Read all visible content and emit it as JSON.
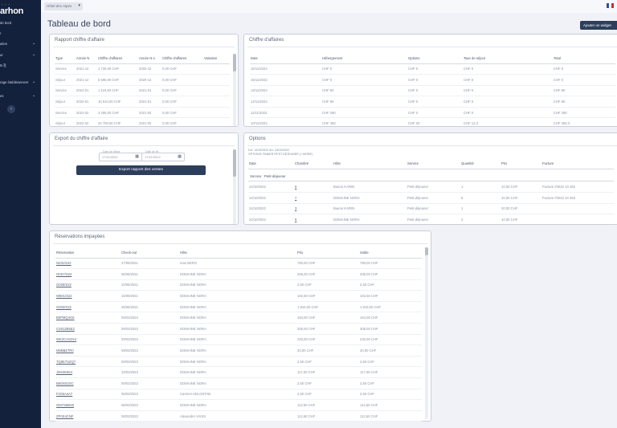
{
  "sidebar": {
    "logo_small": "/ / /",
    "logo": "arhon",
    "items": [
      {
        "label": "de bord",
        "chevron": ""
      },
      {
        "label": "r",
        "chevron": ""
      },
      {
        "label": "ation",
        "chevron": "⌄"
      },
      {
        "label": "ur",
        "chevron": "⌄"
      },
      {
        "label": "ts ⎘",
        "chevron": ""
      },
      {
        "label": "rage établissement",
        "chevron": "⌄"
      },
      {
        "label": "es",
        "chevron": "⌄"
      }
    ],
    "collapse_icon": "‹"
  },
  "topbar": {
    "env_select": "Hôtel des Alpes",
    "env_chevron": "▾",
    "flag_colors": [
      "#2b4fa8",
      "#ffffff",
      "#d2283a"
    ]
  },
  "page": {
    "title": "Tableau de bord",
    "add_widget": "Ajouter un widget"
  },
  "rapport": {
    "title": "Rapport chiffre d'affaire",
    "columns": [
      "Type",
      "Année N",
      "Chiffre d'affaires",
      "Année N-1",
      "Chiffre d'affaires",
      "Variation"
    ],
    "rows": [
      [
        "Service",
        "2021-12",
        "1 726,00 CHF",
        "2020-12",
        "0,00 CHF",
        ""
      ],
      [
        "Séjour",
        "2021-12",
        "8 595,00 CHF",
        "2020-12",
        "0,00 CHF",
        ""
      ],
      [
        "Service",
        "2022-01",
        "1 119,60 CHF",
        "2021-01",
        "0,00 CHF",
        ""
      ],
      [
        "Séjour",
        "2022-01",
        "10 510,00 CHF",
        "2021-01",
        "0,00 CHF",
        ""
      ],
      [
        "Service",
        "2022-02",
        "3 295,00 CHF",
        "2021-02",
        "0,00 CHF",
        ""
      ],
      [
        "Séjour",
        "2022-02",
        "24 700,00 CHF",
        "2021-02",
        "0,00 CHF",
        ""
      ]
    ]
  },
  "chiffre": {
    "title": "Chiffre d'affaires",
    "columns": [
      "Date",
      "Hébergement",
      "Options",
      "Taxe de séjour",
      "Total"
    ],
    "rows": [
      [
        "15/11/2022",
        "CHF 0",
        "CHF 0",
        "CHF 0",
        "CHF 0"
      ],
      [
        "15/11/2022",
        "CHF 0",
        "CHF 0",
        "CHF 0",
        "CHF 0"
      ],
      [
        "13/11/2022",
        "CHF 80",
        "CHF 0",
        "CHF 0",
        "CHF 80"
      ],
      [
        "12/11/2022",
        "CHF 80",
        "CHF 0",
        "CHF 0",
        "CHF 80"
      ],
      [
        "11/11/2022",
        "CHF 280",
        "CHF 0",
        "CHF 0",
        "CHF 280"
      ],
      [
        "10/11/2022",
        "CHF 460",
        "CHF 20",
        "CHF 12,3",
        "CHF 492,3"
      ]
    ]
  },
  "export": {
    "title": "Export du chiffre d'affaire",
    "from_label": "Date de début",
    "from_value": "17/11/2022",
    "to_label": "Date de fin",
    "to_value": "17/11/2022",
    "button": "Export rapport des ventes"
  },
  "options": {
    "title": "Options",
    "meta_line1": "DU: 14/10/2022 AU: 24/10/2022",
    "meta_line2": "OPTIONS: PANIER PETIT DÉJEUNER (+ MORE)",
    "columns": [
      "Date",
      "Chambre",
      "Hôte",
      "Service",
      "Quantité",
      "Prix",
      "Facture"
    ],
    "group_label": "Service : Petit-déjeuner",
    "rows": [
      [
        "24/10/2022",
        "0",
        "Bueno KARIN",
        "Petit-déjeuner",
        "1",
        "10,00 CHF",
        "Facture #2022 10 452"
      ],
      [
        "24/10/2022",
        "7",
        "DOMAINE NORA",
        "Petit-déjeuner",
        "6",
        "10,00 CHF",
        "Facture #2022 10 453"
      ],
      [
        "24/10/2022",
        "3",
        "Bueno KARIN",
        "Petit-déjeuner",
        "1",
        "20,00 CHF",
        ""
      ],
      [
        "24/10/2022",
        "6",
        "DOMAINE NORA",
        "Petit-déjeuner",
        "2",
        "10,00 CHF",
        ""
      ]
    ]
  },
  "reservations": {
    "title": "Réservations impayées",
    "columns": [
      "Réservation",
      "Check-out",
      "Hôte",
      "Prix",
      "Solde"
    ],
    "rows": [
      [
        "N231/S22",
        "27/06/2021",
        "mao BERG",
        "780,00 CHF",
        "780,00 CHF"
      ],
      [
        "O0S7/S22",
        "05/08/2021",
        "DOMAINE NORA",
        "205,00 CHF",
        "205,00 CHF"
      ],
      [
        "G028/S22",
        "10/08/2021",
        "DOMAINE NORA",
        "2,50 CHF",
        "2,50 CHF"
      ],
      [
        "W831/S22",
        "16/09/2021",
        "DOMAINE NORA",
        "102,50 CHF",
        "102,50 CHF"
      ],
      [
        "G003/S22",
        "26/08/2021",
        "DOMAINE NORA",
        "1 810,00 CHF",
        "1 810,00 CHF"
      ],
      [
        "B0PMQ4SS",
        "09/03/2022",
        "DOMAINE NORA",
        "164,00 CHF",
        "164,00 CHF"
      ],
      [
        "CS01Z85E2",
        "09/03/2022",
        "DOMAINE NORA",
        "305,00 CHF",
        "305,00 CHF"
      ],
      [
        "WK2CAS2X4",
        "09/03/2022",
        "DOMAINE NORA",
        "240,00 CHF",
        "240,00 CHF"
      ],
      [
        "M6BBZ7R0",
        "09/03/2022",
        "DOMAINE NORA",
        "20,00 CHF",
        "20,00 CHF"
      ],
      [
        "TQ8E7SZQ7",
        "09/03/2022",
        "DOMAINE NORA",
        "2,50 CHF",
        "2,50 CHF"
      ],
      [
        "J0H8S9S4",
        "10/03/2022",
        "DOMAINE NORA",
        "117,00 CHF",
        "117,00 CHF"
      ],
      [
        "B6O6S2SC",
        "09/03/2022",
        "DOMAINE NORA",
        "2,50 CHF",
        "2,50 CHF"
      ],
      [
        "F2S5A4A7",
        "08/03/2022",
        "Carmen HELOSTAB",
        "2,50 CHF",
        "2,50 CHF"
      ],
      [
        "GM7S5BS0",
        "08/03/2022",
        "DOMAINE NORA",
        "112,50 CHF",
        "112,50 CHF"
      ],
      [
        "ZP0S4CNF",
        "08/03/2022",
        "Alexandre VAISS",
        "112,50 CHF",
        "112,50 CHF"
      ]
    ]
  }
}
